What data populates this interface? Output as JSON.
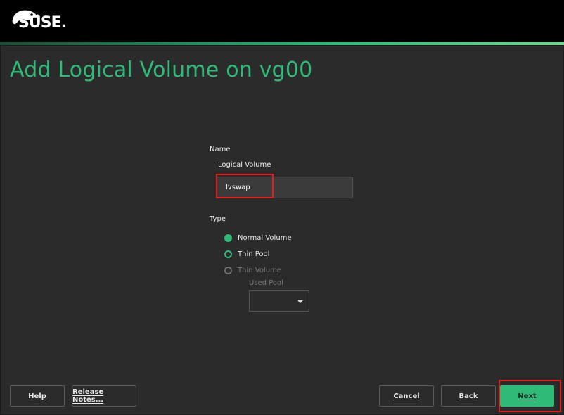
{
  "brand": {
    "logo_text": "SUSE."
  },
  "header": {
    "title": "Add Logical Volume on vg00"
  },
  "form": {
    "name_section_label": "Name",
    "logical_volume_label": "Logical Volume",
    "logical_volume_value": "lvswap",
    "type_section_label": "Type",
    "radios": [
      {
        "label": "Normal Volume",
        "checked": true,
        "enabled": true
      },
      {
        "label": "Thin Pool",
        "checked": false,
        "enabled": true
      },
      {
        "label": "Thin Volume",
        "checked": false,
        "enabled": false
      }
    ],
    "used_pool_label": "Used Pool",
    "used_pool_value": ""
  },
  "buttons": {
    "help": "Help",
    "release_notes": "Release Notes...",
    "cancel": "Cancel",
    "back": "Back",
    "next": "Next"
  },
  "colors": {
    "accent": "#30ba78",
    "background": "#2b2b2b",
    "topbar": "#000000",
    "highlight": "#e0201c"
  },
  "icons": [
    "suse-chameleon-logo-icon",
    "radio-checked-icon",
    "radio-unchecked-icon",
    "chevron-down-icon"
  ]
}
